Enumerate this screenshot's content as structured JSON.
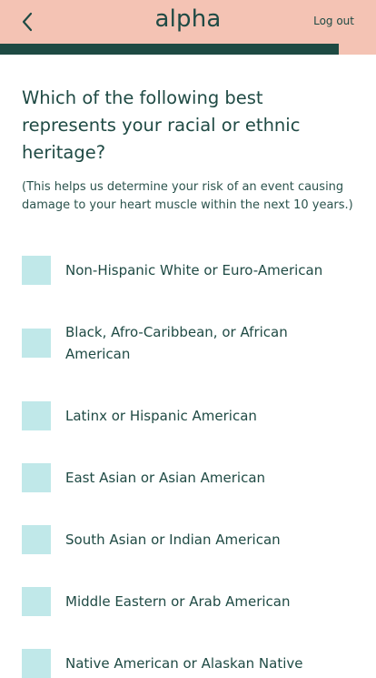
{
  "header": {
    "brand": "alpha",
    "logout_label": "Log out",
    "back_icon": "chevron-left-icon",
    "background": "#f4c3b4"
  },
  "progress": {
    "fraction": 0.9,
    "fill_color": "#1e4a43"
  },
  "question": {
    "title": "Which of the following best represents your racial or ethnic heritage?",
    "helper": "(This helps us determine your risk of an event causing damage to your heart muscle within the next 10 years.)"
  },
  "options": [
    {
      "label": "Non-Hispanic White or Euro-American"
    },
    {
      "label": "Black, Afro-Caribbean, or African American"
    },
    {
      "label": "Latinx or Hispanic American"
    },
    {
      "label": "East Asian or Asian American"
    },
    {
      "label": "South Asian or Indian American"
    },
    {
      "label": "Middle Eastern or Arab American"
    },
    {
      "label": "Native American or Alaskan Native"
    }
  ],
  "colors": {
    "checkbox": "#c0e8e9",
    "text": "#1f4a44"
  }
}
